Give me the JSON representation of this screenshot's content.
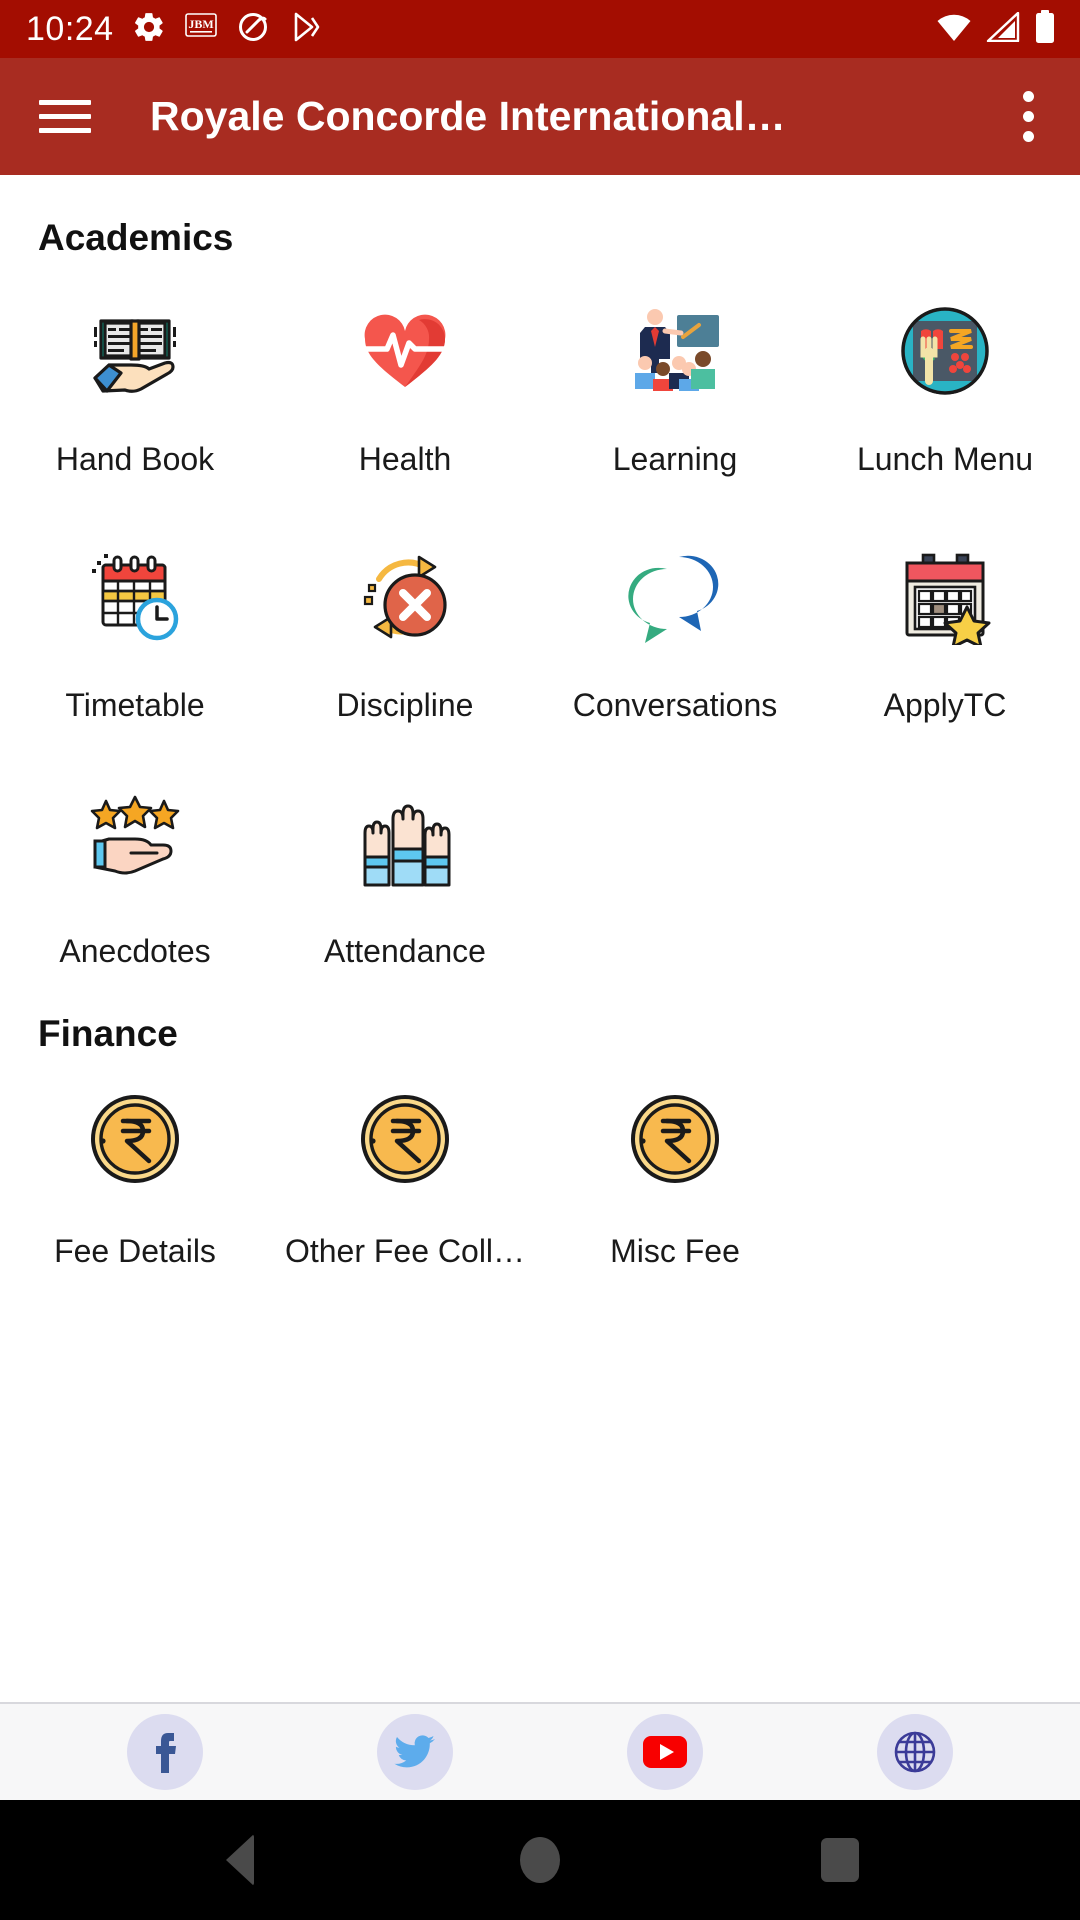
{
  "status_bar": {
    "clock": "10:24",
    "left_icons": [
      "gear-icon",
      "jbm-app-icon",
      "do-not-disturb-icon",
      "play-store-icon"
    ],
    "right_icons": [
      "wifi-icon",
      "cellular-signal-icon",
      "battery-icon"
    ],
    "background_color": "#a30d01"
  },
  "app_bar": {
    "menu_icon": "hamburger-menu-icon",
    "title": "Royale Concorde International…",
    "overflow_icon": "more-vertical-icon",
    "background_color": "#a82c21"
  },
  "sections": [
    {
      "id": "academics",
      "title": "Academics",
      "items": [
        {
          "label": "Hand Book",
          "icon": "hand-book-icon"
        },
        {
          "label": "Health",
          "icon": "health-heart-icon"
        },
        {
          "label": "Learning",
          "icon": "learning-classroom-icon"
        },
        {
          "label": "Lunch Menu",
          "icon": "lunch-menu-tray-icon"
        },
        {
          "label": "Timetable",
          "icon": "timetable-calendar-clock-icon"
        },
        {
          "label": "Discipline",
          "icon": "discipline-x-circle-icon"
        },
        {
          "label": "Conversations",
          "icon": "conversations-chat-bubbles-icon"
        },
        {
          "label": "ApplyTC",
          "icon": "applytc-calendar-star-icon"
        },
        {
          "label": "Anecdotes",
          "icon": "anecdotes-hand-stars-icon"
        },
        {
          "label": "Attendance",
          "icon": "attendance-raised-hands-icon"
        }
      ]
    },
    {
      "id": "finance",
      "title": "Finance",
      "items": [
        {
          "label": "Fee Details",
          "icon": "rupee-coin-icon"
        },
        {
          "label": "Other Fee Coll…",
          "icon": "rupee-coin-icon"
        },
        {
          "label": "Misc Fee",
          "icon": "rupee-coin-icon"
        }
      ]
    }
  ],
  "social_bar": {
    "items": [
      {
        "name": "facebook",
        "icon": "facebook-icon",
        "color": "#3a5795"
      },
      {
        "name": "twitter",
        "icon": "twitter-icon",
        "color": "#5dacec"
      },
      {
        "name": "youtube",
        "icon": "youtube-icon",
        "color": "#f80000"
      },
      {
        "name": "website",
        "icon": "globe-icon",
        "color": "#3b3b98"
      }
    ],
    "background_color": "#f7f7f8"
  },
  "nav_bar": {
    "buttons": [
      {
        "name": "back",
        "icon": "back-triangle-icon"
      },
      {
        "name": "home",
        "icon": "home-circle-icon"
      },
      {
        "name": "recent",
        "icon": "recents-square-icon"
      }
    ],
    "background_color": "#000000"
  }
}
